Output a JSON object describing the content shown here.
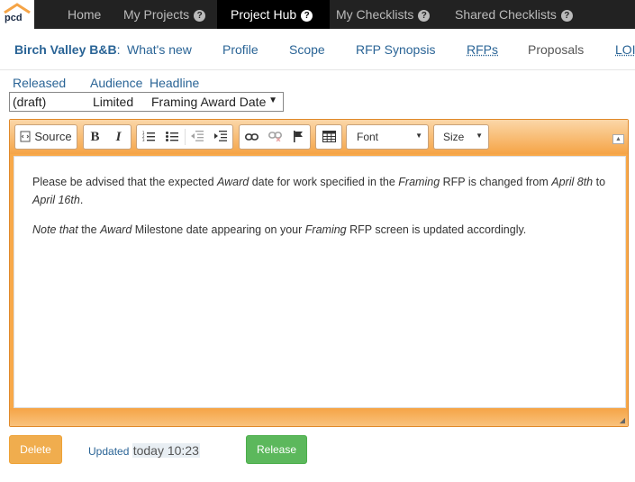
{
  "app": {
    "logo_text": "pcd"
  },
  "topnav": {
    "items": [
      {
        "label": "Home",
        "help": false
      },
      {
        "label": "My Projects",
        "help": true
      },
      {
        "label": "Project Hub",
        "help": true,
        "active": true
      },
      {
        "label": "My Checklists",
        "help": true
      },
      {
        "label": "Shared Checklists",
        "help": true
      }
    ],
    "help_glyph": "?"
  },
  "subnav": {
    "brand": "Birch Valley B&B",
    "brand_suffix": ":",
    "links": [
      "What's new",
      "Profile",
      "Scope",
      "RFP Synopsis",
      "RFPs",
      "Proposals",
      "LOI"
    ]
  },
  "form": {
    "headers": {
      "released": "Released",
      "audience": "Audience",
      "headline": "Headline"
    },
    "released": "(draft)",
    "audience": "Limited",
    "headline": "Framing Award Date"
  },
  "toolbar": {
    "source_label": "Source",
    "bold_label": "B",
    "italic_label": "I",
    "font_label": "Font",
    "size_label": "Size"
  },
  "editor_content": {
    "p1": [
      {
        "t": "Please be advised that the expected ",
        "i": false
      },
      {
        "t": "Award",
        "i": true
      },
      {
        "t": " date for work specified in the ",
        "i": false
      },
      {
        "t": "Framing",
        "i": true
      },
      {
        "t": " RFP is changed from ",
        "i": false
      },
      {
        "t": "April 8th",
        "i": true
      },
      {
        "t": " to ",
        "i": false
      },
      {
        "t": "April 16th",
        "i": true
      },
      {
        "t": ".",
        "i": false
      }
    ],
    "p2": [
      {
        "t": "Note that",
        "i": true
      },
      {
        "t": " the ",
        "i": false
      },
      {
        "t": "Award",
        "i": true
      },
      {
        "t": " Milestone date appearing on your ",
        "i": false
      },
      {
        "t": "Framing",
        "i": true
      },
      {
        "t": " RFP screen is updated accordingly.",
        "i": false
      }
    ]
  },
  "footer": {
    "delete_label": "Delete",
    "updated_label": "Updated",
    "updated_value": "today 10:23",
    "release_label": "Release"
  },
  "colors": {
    "nav_bg": "#222222",
    "accent_orange": "#f5a446",
    "link_blue": "#2a6496",
    "delete_orange": "#f0ad4e",
    "release_green": "#5cb85c"
  }
}
